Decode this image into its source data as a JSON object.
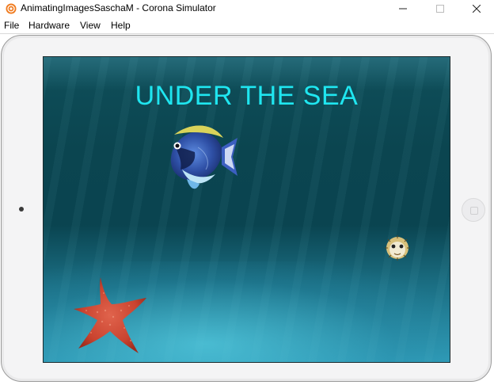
{
  "window": {
    "title": "AnimatingImagesSaschaM - Corona Simulator",
    "app_icon": "corona-logo-icon",
    "controls": [
      "minimize-icon",
      "maximize-icon",
      "close-icon"
    ]
  },
  "menu": {
    "items": [
      {
        "label": "File"
      },
      {
        "label": "Hardware"
      },
      {
        "label": "View"
      },
      {
        "label": "Help"
      }
    ]
  },
  "device": {
    "type": "tablet",
    "home_button_icon": "home-button-icon"
  },
  "scene": {
    "title": "UNDER THE SEA",
    "title_color": "#1fe6f0",
    "background": "underwater",
    "sprites": [
      "tang-fish",
      "pufferfish",
      "starfish"
    ]
  },
  "colors": {
    "app_icon": "#f07a1d",
    "starfish": "#c9432f",
    "fish_body": "#2f4fa8"
  }
}
